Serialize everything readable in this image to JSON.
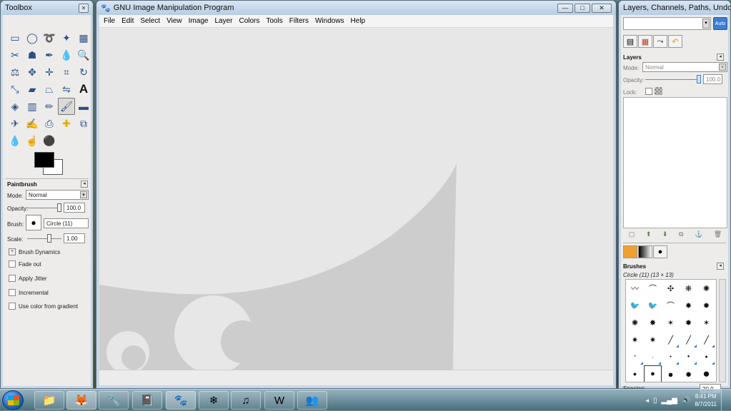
{
  "toolbox": {
    "title": "Toolbox",
    "tool_options_title": "Paintbrush",
    "mode_label": "Mode:",
    "mode_value": "Normal",
    "opacity_label": "Opacity:",
    "opacity_value": "100.0",
    "brush_label": "Brush:",
    "brush_value": "Circle (11)",
    "scale_label": "Scale:",
    "scale_value": "1.00",
    "brush_dynamics": "Brush Dynamics",
    "fade_out": "Fade out",
    "apply_jitter": "Apply Jitter",
    "incremental": "Incremental",
    "use_color_gradient": "Use color from gradient"
  },
  "main_window": {
    "title": "GNU Image Manipulation Program",
    "menus": [
      "File",
      "Edit",
      "Select",
      "View",
      "Image",
      "Layer",
      "Colors",
      "Tools",
      "Filters",
      "Windows",
      "Help"
    ]
  },
  "dock": {
    "title": "Layers, Channels, Paths, Undo - P...",
    "auto_label": "Auto",
    "layers_title": "Layers",
    "mode_label": "Mode:",
    "mode_value": "Normal",
    "opacity_label": "Opacity:",
    "opacity_value": "100.0",
    "lock_label": "Lock:",
    "brushes_title": "Brushes",
    "brush_info": "Circle (11) (13 × 13)",
    "spacing_label": "Spacing:",
    "spacing_value": "20.0"
  },
  "taskbar": {
    "time": "8:41 PM",
    "date": "8/7/2011"
  },
  "colors": {
    "canvas_bg": "#e7e7e7",
    "wilber_gray": "#cdcdcd",
    "taskbar_accent": "#3b7fd4"
  }
}
